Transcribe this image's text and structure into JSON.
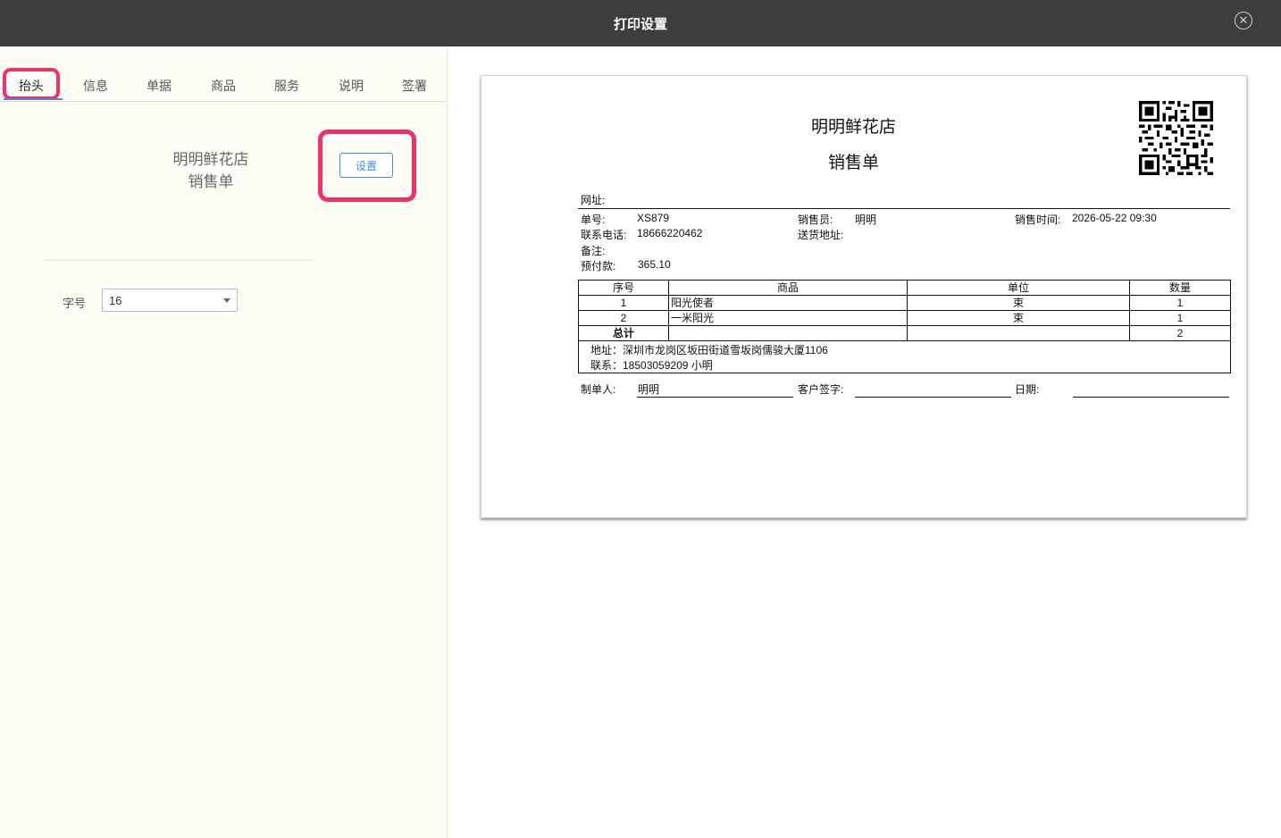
{
  "window": {
    "title": "打印设置",
    "close_icon": "ⓧ"
  },
  "tabs": [
    "抬头",
    "信息",
    "单据",
    "商品",
    "服务",
    "说明",
    "签署"
  ],
  "header_panel": {
    "store_name": "明明鲜花店",
    "doc_title": "销售单",
    "settings_button": "设置",
    "font_size_label": "字号",
    "font_size_value": "16"
  },
  "preview": {
    "store_name": "明明鲜花店",
    "doc_title": "销售单",
    "website_label": "网址:",
    "order_no_label": "单号:",
    "order_no": "XS879",
    "salesperson_label": "销售员:",
    "salesperson": "明明",
    "sale_time_label": "销售时间:",
    "sale_time": "2026-05-22 09:30",
    "phone_label": "联系电话:",
    "phone": "18666220462",
    "delivery_label": "送货地址:",
    "remark_label": "备注:",
    "prepaid_label": "预付款:",
    "prepaid": "365.10",
    "table": {
      "headers": [
        "序号",
        "商品",
        "单位",
        "数量"
      ],
      "rows": [
        [
          "1",
          "阳光使者",
          "束",
          "1"
        ],
        [
          "2",
          "一米阳光",
          "束",
          "1"
        ]
      ],
      "total_label": "总计",
      "total_qty": "2"
    },
    "address_line": "地址：深圳市龙岗区坂田街道雪坂岗儒骏大厦1106",
    "contact_line": "联系：18503059209 小明",
    "maker_label": "制单人:",
    "maker": "明明",
    "signature_label": "客户签字:",
    "date_label": "日期:"
  },
  "colors": {
    "titlebar": "#3d3d3d",
    "highlight": "#f0306a",
    "accent": "#3a8ee6",
    "left_panel_bg": "#fdfdf6"
  }
}
